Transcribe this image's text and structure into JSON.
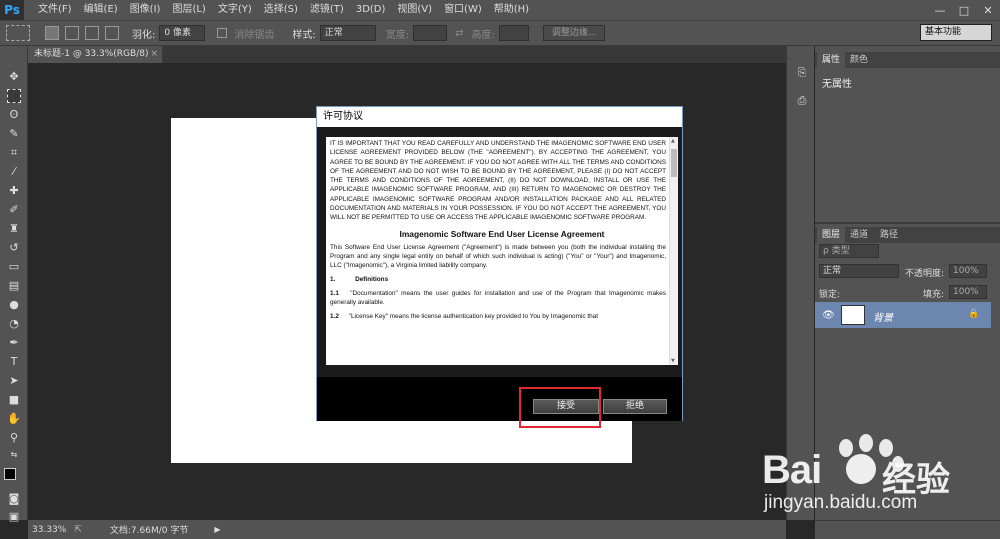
{
  "app": {
    "logo": "Ps",
    "menu": [
      "文件(F)",
      "编辑(E)",
      "图像(I)",
      "图层(L)",
      "文字(Y)",
      "选择(S)",
      "滤镜(T)",
      "3D(D)",
      "视图(V)",
      "窗口(W)",
      "帮助(H)"
    ],
    "window_controls": [
      "—",
      "□",
      "✕"
    ]
  },
  "options": {
    "feather_label": "羽化:",
    "feather_value": "0 像素",
    "antialias_label": "消除锯齿",
    "style_label": "样式:",
    "style_value": "正常",
    "width_label": "宽度:",
    "height_label": "高度:",
    "refine_button": "调整边缘...",
    "workspace": "基本功能"
  },
  "document": {
    "tab_title": "未标题-1 @ 33.3%(RGB/8)",
    "tab_close": "×"
  },
  "status": {
    "zoom": "33.33%",
    "doc_info": "文档:7.66M/0 字节"
  },
  "panels": {
    "tabs_top": [
      "属性",
      "颜色"
    ],
    "props_text": "无属性",
    "tabs_layers": [
      "图层",
      "通道",
      "路径"
    ],
    "kind_label": "ρ 类型",
    "blend_mode": "正常",
    "opacity_label": "不透明度:",
    "opacity_value": "100%",
    "lock_label": "锁定:",
    "fill_label": "填充:",
    "fill_value": "100%",
    "layer_name": "背景"
  },
  "dialog": {
    "title": "许可协议",
    "intro": "IT IS IMPORTANT THAT YOU READ CAREFULLY AND UNDERSTAND THE IMAGENOMIC SOFTWARE END USER LICENSE AGREEMENT PROVIDED BELOW (THE \"AGREEMENT\"). BY ACCEPTING THE AGREEMENT, YOU AGREE TO BE BOUND BY THE AGREEMENT. IF YOU DO NOT AGREE WITH ALL THE TERMS AND CONDITIONS OF THE AGREEMENT AND DO NOT WISH TO BE BOUND BY THE AGREEMENT, PLEASE (I) DO NOT ACCEPT THE TERMS AND CONDITIONS OF THE AGREEMENT, (II) DO NOT DOWNLOAD, INSTALL OR USE THE APPLICABLE IMAGENOMIC SOFTWARE PROGRAM, AND (III) RETURN TO IMAGENOMIC OR DESTROY THE APPLICABLE IMAGENOMIC SOFTWARE PROGRAM AND/OR INSTALLATION PACKAGE AND ALL RELATED DOCUMENTATION AND MATERIALS IN YOUR POSSESSION. IF YOU DO NOT ACCEPT THE AGREEMENT, YOU WILL NOT BE PERMITTED TO USE OR ACCESS THE APPLICABLE IMAGENOMIC SOFTWARE PROGRAM.",
    "heading": "Imagenomic Software End User License Agreement",
    "para1": "This Software End User License Agreement (\"Agreement\") is made between you (both the individual installing the Program and any single legal entity on behalf of which such individual is acting) (\"You\" or \"Your\") and Imagenomic, LLC (\"Imagenomic\"), a Virginia limited liability company.",
    "sec1_num": "1.",
    "sec1_title": "Definitions",
    "def11_num": "1.1",
    "def11": "\"Documentation\" means the user guides for installation and use of the Program that Imagenomic makes generally available.",
    "def12_num": "1.2",
    "def12": "\"License Key\" means the license authentication key provided to You by Imagenomic that",
    "accept": "接受",
    "reject": "拒绝"
  },
  "watermark": {
    "brand_a": "Bai",
    "brand_b": "经验",
    "url": "jingyan.baidu.com"
  }
}
